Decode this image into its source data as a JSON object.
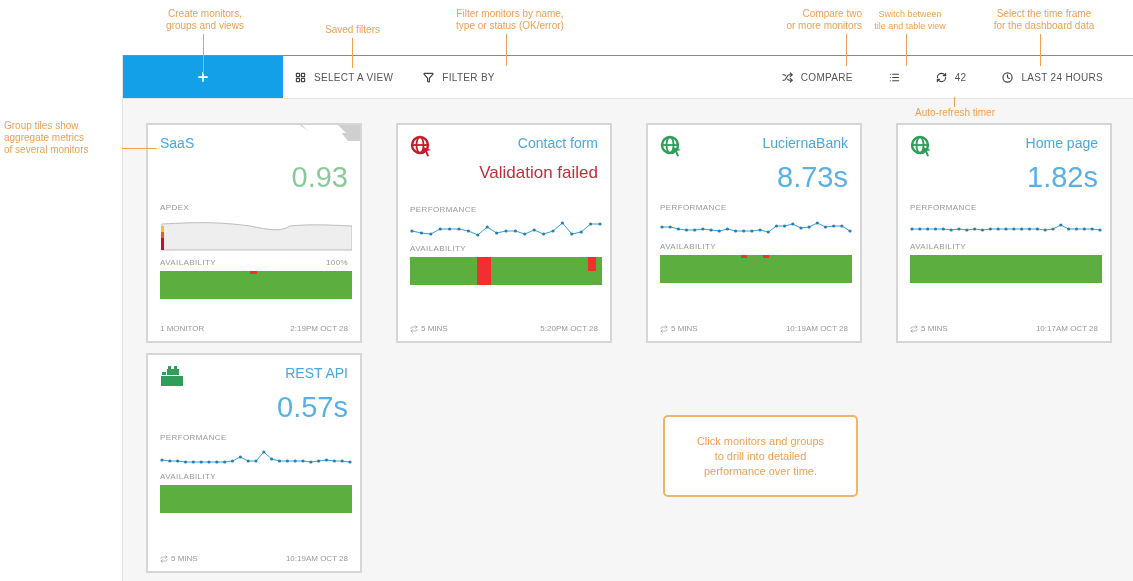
{
  "annotations": [
    {
      "kind": "top",
      "text": "Create monitors,\ngroups and views"
    },
    {
      "kind": "top",
      "text": "Saved filters"
    },
    {
      "kind": "top",
      "text": "Filter monitors by name,\ntype or status (OK/error)"
    },
    {
      "kind": "top",
      "text": "Compare two\nor more monitors"
    },
    {
      "kind": "top",
      "text": "Switch between\ntile and table view"
    },
    {
      "kind": "top",
      "text": "Select the time frame\nfor the dashboard data"
    },
    {
      "kind": "below",
      "text": "Auto-refresh timer"
    },
    {
      "kind": "left",
      "text": "Group tiles show\naggregate metrics\nof several monitors"
    },
    {
      "kind": "box",
      "text": "Click monitors and groups\nto drill into detailed\nperformance over time."
    }
  ],
  "toolbar": {
    "left": [
      {
        "kind": "add"
      },
      {
        "kind": "views",
        "label": "SELECT A VIEW"
      },
      {
        "kind": "filter",
        "label": "FILTER BY"
      }
    ],
    "right": [
      {
        "kind": "compare",
        "label": "COMPARE"
      },
      {
        "kind": "layout"
      },
      {
        "kind": "refresh",
        "label": "42"
      },
      {
        "kind": "time",
        "label": "LAST 24 HOURS"
      }
    ]
  },
  "tiles": [
    {
      "kind": "group",
      "failed": false,
      "title": "SaaS",
      "value": "0.93",
      "metric": "APDEX",
      "availability_label": "AVAILABILITY",
      "availability_value": "100%",
      "footer_left": "1 MONITOR",
      "footer_right": "2:19PM OCT 28"
    },
    {
      "kind": "browser",
      "failed": true,
      "title": "Contact form",
      "value": "Validation failed",
      "metric": "PERFORMANCE",
      "availability_label": "AVAILABILITY",
      "footer_left": "5 MINS",
      "footer_right": "5:20PM OCT 28"
    },
    {
      "kind": "browser",
      "failed": false,
      "title": "LuciernaBank",
      "value": "8.73s",
      "metric": "PERFORMANCE",
      "availability_label": "AVAILABILITY",
      "footer_left": "5 MINS",
      "footer_right": "10:19AM OCT 28"
    },
    {
      "kind": "browser",
      "failed": false,
      "title": "Home page",
      "value": "1.82s",
      "metric": "PERFORMANCE",
      "availability_label": "AVAILABILITY",
      "footer_left": "5 MINS",
      "footer_right": "10:17AM OCT 28"
    },
    {
      "kind": "api",
      "failed": false,
      "title": "REST API",
      "value": "0.57s",
      "metric": "PERFORMANCE",
      "availability_label": "AVAILABILITY",
      "footer_left": "5 MINS",
      "footer_right": "10:19AM OCT 28"
    }
  ]
}
